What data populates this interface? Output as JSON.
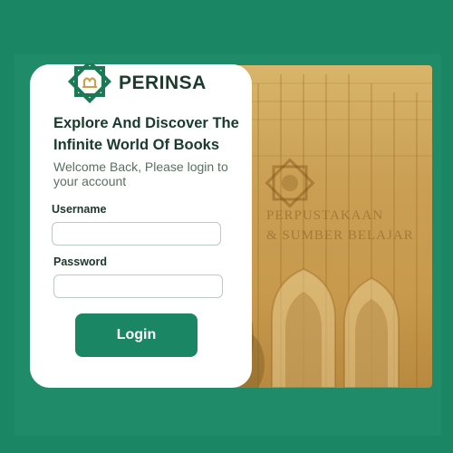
{
  "brand": {
    "name": "PERINSA",
    "logo_icon": "perinsa-logo-icon",
    "accent": "#1b8663"
  },
  "hero": {
    "headline": "Explore And Discover The Infinite World Of Books",
    "welcome": "Welcome Back, Please login to your account"
  },
  "form": {
    "username_label": "Username",
    "username_value": "",
    "password_label": "Password",
    "password_value": "",
    "login_label": "Login"
  },
  "photo": {
    "sign_line1": "PERPUSTAKAAN",
    "sign_line2": "& SUMBER BELAJAR"
  }
}
